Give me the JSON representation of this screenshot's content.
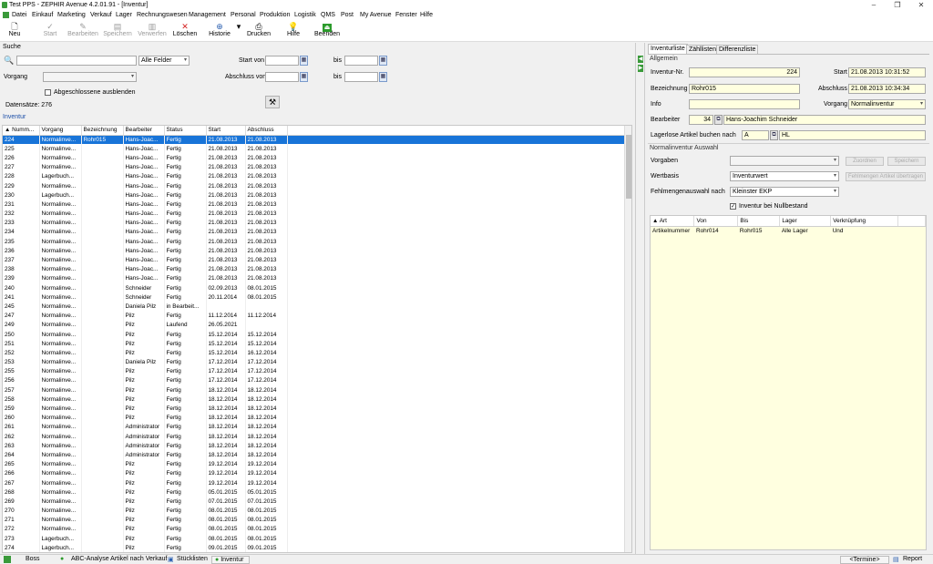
{
  "window": {
    "title": "Test PPS - ZEPHIR Avenue 4.2.01.91 - [Inventur]",
    "controls": [
      "–",
      "❐",
      "✕"
    ]
  },
  "menu": [
    "Datei",
    "Einkauf",
    "Marketing",
    "Verkauf",
    "Lager",
    "Rechnungswesen",
    "Management",
    "Personal",
    "Produktion",
    "Logistik",
    "QMS",
    "Post",
    "My Avenue",
    "Fenster",
    "Hilfe"
  ],
  "toolbar": {
    "neu": "Neu",
    "start": "Start",
    "bearbeiten": "Bearbeiten",
    "speichern": "Speichern",
    "verwerfen": "Verwerfen",
    "loeschen": "Löschen",
    "historie": "Historie",
    "drucken": "Drucken",
    "hilfe": "Hilfe",
    "beenden": "Beenden"
  },
  "search": {
    "title": "Suche",
    "field_value": "",
    "field_scope": "Alle Felder",
    "start_von": "Start von",
    "bis": "bis",
    "abschluss_von": "Abschluss von",
    "vorgang_label": "Vorgang",
    "vorgang_value": "",
    "hide_closed_label": "Abgeschlossene ausblenden",
    "datensaetze": "Datensätze: 276"
  },
  "grid": {
    "title": "Inventur",
    "columns": [
      "▲ Numm...",
      "Vorgang",
      "Bezeichnung",
      "Bearbeiter",
      "Status",
      "Start",
      "Abschluss"
    ],
    "rows": [
      [
        "224",
        "Normalinve...",
        "Rohr015",
        "Hans-Joac...",
        "Fertig",
        "21.08.2013",
        "21.08.2013"
      ],
      [
        "225",
        "Normalinve...",
        "",
        "Hans-Joac...",
        "Fertig",
        "21.08.2013",
        "21.08.2013"
      ],
      [
        "226",
        "Normalinve...",
        "",
        "Hans-Joac...",
        "Fertig",
        "21.08.2013",
        "21.08.2013"
      ],
      [
        "227",
        "Normalinve...",
        "",
        "Hans-Joac...",
        "Fertig",
        "21.08.2013",
        "21.08.2013"
      ],
      [
        "228",
        "Lagerbuch...",
        "",
        "Hans-Joac...",
        "Fertig",
        "21.08.2013",
        "21.08.2013"
      ],
      [
        "229",
        "Normalinve...",
        "",
        "Hans-Joac...",
        "Fertig",
        "21.08.2013",
        "21.08.2013"
      ],
      [
        "230",
        "Lagerbuch...",
        "",
        "Hans-Joac...",
        "Fertig",
        "21.08.2013",
        "21.08.2013"
      ],
      [
        "231",
        "Normalinve...",
        "",
        "Hans-Joac...",
        "Fertig",
        "21.08.2013",
        "21.08.2013"
      ],
      [
        "232",
        "Normalinve...",
        "",
        "Hans-Joac...",
        "Fertig",
        "21.08.2013",
        "21.08.2013"
      ],
      [
        "233",
        "Normalinve...",
        "",
        "Hans-Joac...",
        "Fertig",
        "21.08.2013",
        "21.08.2013"
      ],
      [
        "234",
        "Normalinve...",
        "",
        "Hans-Joac...",
        "Fertig",
        "21.08.2013",
        "21.08.2013"
      ],
      [
        "235",
        "Normalinve...",
        "",
        "Hans-Joac...",
        "Fertig",
        "21.08.2013",
        "21.08.2013"
      ],
      [
        "236",
        "Normalinve...",
        "",
        "Hans-Joac...",
        "Fertig",
        "21.08.2013",
        "21.08.2013"
      ],
      [
        "237",
        "Normalinve...",
        "",
        "Hans-Joac...",
        "Fertig",
        "21.08.2013",
        "21.08.2013"
      ],
      [
        "238",
        "Normalinve...",
        "",
        "Hans-Joac...",
        "Fertig",
        "21.08.2013",
        "21.08.2013"
      ],
      [
        "239",
        "Normalinve...",
        "",
        "Hans-Joac...",
        "Fertig",
        "21.08.2013",
        "21.08.2013"
      ],
      [
        "240",
        "Normalinve...",
        "",
        "Schneider",
        "Fertig",
        "02.09.2013",
        "08.01.2015"
      ],
      [
        "241",
        "Normalinve...",
        "",
        "Schneider",
        "Fertig",
        "20.11.2014",
        "08.01.2015"
      ],
      [
        "245",
        "Normalinve...",
        "",
        "Daniela Pilz",
        "in Bearbeit...",
        "",
        ""
      ],
      [
        "247",
        "Normalinve...",
        "",
        "Pilz",
        "Fertig",
        "11.12.2014",
        "11.12.2014"
      ],
      [
        "249",
        "Normalinve...",
        "",
        "Pilz",
        "Laufend",
        "26.05.2021",
        ""
      ],
      [
        "250",
        "Normalinve...",
        "",
        "Pilz",
        "Fertig",
        "15.12.2014",
        "15.12.2014"
      ],
      [
        "251",
        "Normalinve...",
        "",
        "Pilz",
        "Fertig",
        "15.12.2014",
        "15.12.2014"
      ],
      [
        "252",
        "Normalinve...",
        "",
        "Pilz",
        "Fertig",
        "15.12.2014",
        "16.12.2014"
      ],
      [
        "253",
        "Normalinve...",
        "",
        "Daniela Pilz",
        "Fertig",
        "17.12.2014",
        "17.12.2014"
      ],
      [
        "255",
        "Normalinve...",
        "",
        "Pilz",
        "Fertig",
        "17.12.2014",
        "17.12.2014"
      ],
      [
        "256",
        "Normalinve...",
        "",
        "Pilz",
        "Fertig",
        "17.12.2014",
        "17.12.2014"
      ],
      [
        "257",
        "Normalinve...",
        "",
        "Pilz",
        "Fertig",
        "18.12.2014",
        "18.12.2014"
      ],
      [
        "258",
        "Normalinve...",
        "",
        "Pilz",
        "Fertig",
        "18.12.2014",
        "18.12.2014"
      ],
      [
        "259",
        "Normalinve...",
        "",
        "Pilz",
        "Fertig",
        "18.12.2014",
        "18.12.2014"
      ],
      [
        "260",
        "Normalinve...",
        "",
        "Pilz",
        "Fertig",
        "18.12.2014",
        "18.12.2014"
      ],
      [
        "261",
        "Normalinve...",
        "",
        "Administrator",
        "Fertig",
        "18.12.2014",
        "18.12.2014"
      ],
      [
        "262",
        "Normalinve...",
        "",
        "Administrator",
        "Fertig",
        "18.12.2014",
        "18.12.2014"
      ],
      [
        "263",
        "Normalinve...",
        "",
        "Administrator",
        "Fertig",
        "18.12.2014",
        "18.12.2014"
      ],
      [
        "264",
        "Normalinve...",
        "",
        "Administrator",
        "Fertig",
        "18.12.2014",
        "18.12.2014"
      ],
      [
        "265",
        "Normalinve...",
        "",
        "Pilz",
        "Fertig",
        "19.12.2014",
        "19.12.2014"
      ],
      [
        "266",
        "Normalinve...",
        "",
        "Pilz",
        "Fertig",
        "19.12.2014",
        "19.12.2014"
      ],
      [
        "267",
        "Normalinve...",
        "",
        "Pilz",
        "Fertig",
        "19.12.2014",
        "19.12.2014"
      ],
      [
        "268",
        "Normalinve...",
        "",
        "Pilz",
        "Fertig",
        "05.01.2015",
        "05.01.2015"
      ],
      [
        "269",
        "Normalinve...",
        "",
        "Pilz",
        "Fertig",
        "07.01.2015",
        "07.01.2015"
      ],
      [
        "270",
        "Normalinve...",
        "",
        "Pilz",
        "Fertig",
        "08.01.2015",
        "08.01.2015"
      ],
      [
        "271",
        "Normalinve...",
        "",
        "Pilz",
        "Fertig",
        "08.01.2015",
        "08.01.2015"
      ],
      [
        "272",
        "Normalinve...",
        "",
        "Pilz",
        "Fertig",
        "08.01.2015",
        "08.01.2015"
      ],
      [
        "273",
        "Lagerbuch...",
        "",
        "Pilz",
        "Fertig",
        "08.01.2015",
        "08.01.2015"
      ],
      [
        "274",
        "Lagerbuch...",
        "",
        "Pilz",
        "Fertig",
        "09.01.2015",
        "09.01.2015"
      ]
    ]
  },
  "right": {
    "tabs": [
      "Inventurliste",
      "Zähllisten",
      "Differenzliste"
    ],
    "allgemein": "Allgemein",
    "inventur_nr_label": "Inventur-Nr.",
    "inventur_nr": "224",
    "start_label": "Start",
    "start_value": "21.08.2013 10:31:52",
    "bezeichnung_label": "Bezeichnung",
    "bezeichnung": "Rohr015",
    "abschluss_label": "Abschluss",
    "abschluss_value": "21.08.2013 10:34:34",
    "info_label": "Info",
    "info": "",
    "vorgang_label": "Vorgang",
    "vorgang": "Normalinventur",
    "bearbeiter_label": "Bearbeiter",
    "bearbeiter_nr": "34",
    "bearbeiter_name": "Hans-Joachim Schneider",
    "lagerlose_label": "Lagerlose Artikel buchen nach",
    "lagerlose_code": "A",
    "lagerlose_name": "HL",
    "auswahl_title": "Normalinventur Auswahl",
    "vorgaben_label": "Vorgaben",
    "vorgaben": "",
    "wertbasis_label": "Wertbasis",
    "wertbasis": "Inventurwert",
    "fehlmengen_label": "Fehlmengenauswahl nach",
    "fehlmengen": "Kleinster EKP",
    "nullbestand_label": "Inventur bei Nullbestand",
    "btn_1": "Zuordnen",
    "btn_2": "Speichern",
    "btn_3": "Fehlmengen Artikel übertragen",
    "columns": [
      "▲ Art",
      "Von",
      "Bis",
      "Lager",
      "Verknüpfung"
    ],
    "rows": [
      [
        "Artikelnummer",
        "Rohr014",
        "Rohr015",
        "Alle Lager",
        "Und"
      ]
    ]
  },
  "status": {
    "user": "Boss",
    "tab1": "ABC-Analyse Artikel nach Verkauf",
    "tab2": "Stücklisten",
    "tab3": "Inventur",
    "termine": "<Termine>",
    "report": "Report"
  },
  "colors": {
    "selection": "#1874d8",
    "yellow_field": "#ffffe0",
    "accent_green": "#2c9b2c"
  }
}
